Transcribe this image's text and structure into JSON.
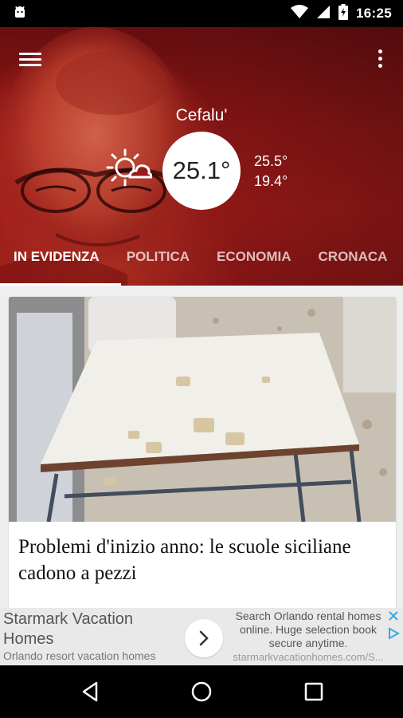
{
  "status_bar": {
    "time": "16:25",
    "icons": [
      "android-robot-icon",
      "wifi-icon",
      "cellular-signal-icon",
      "battery-charging-icon"
    ]
  },
  "header": {
    "menu_icon": "hamburger-menu-icon",
    "more_icon": "more-vertical-icon"
  },
  "weather": {
    "city": "Cefalu'",
    "icon": "partly-cloudy-sun-icon",
    "current_temp": "25.1°",
    "high_temp": "25.5°",
    "low_temp": "19.4°"
  },
  "tabs": [
    {
      "label": "IN EVIDENZA",
      "active": true
    },
    {
      "label": "POLITICA",
      "active": false
    },
    {
      "label": "ECONOMIA",
      "active": false
    },
    {
      "label": "CRONACA",
      "active": false
    }
  ],
  "article": {
    "title": "Problemi d'inizio anno: le scuole siciliane cadono a pezzi"
  },
  "ad": {
    "headline": "Starmark Vacation Homes",
    "subline": "Orlando resort vacation homes",
    "body": "Search Orlando rental homes online. Huge selection book secure anytime.",
    "url": "starmarkvacationhomes.com/S..."
  },
  "colors": {
    "hero_red": "#9b1a19",
    "tab_active": "#ffffff",
    "background": "#efefef"
  }
}
